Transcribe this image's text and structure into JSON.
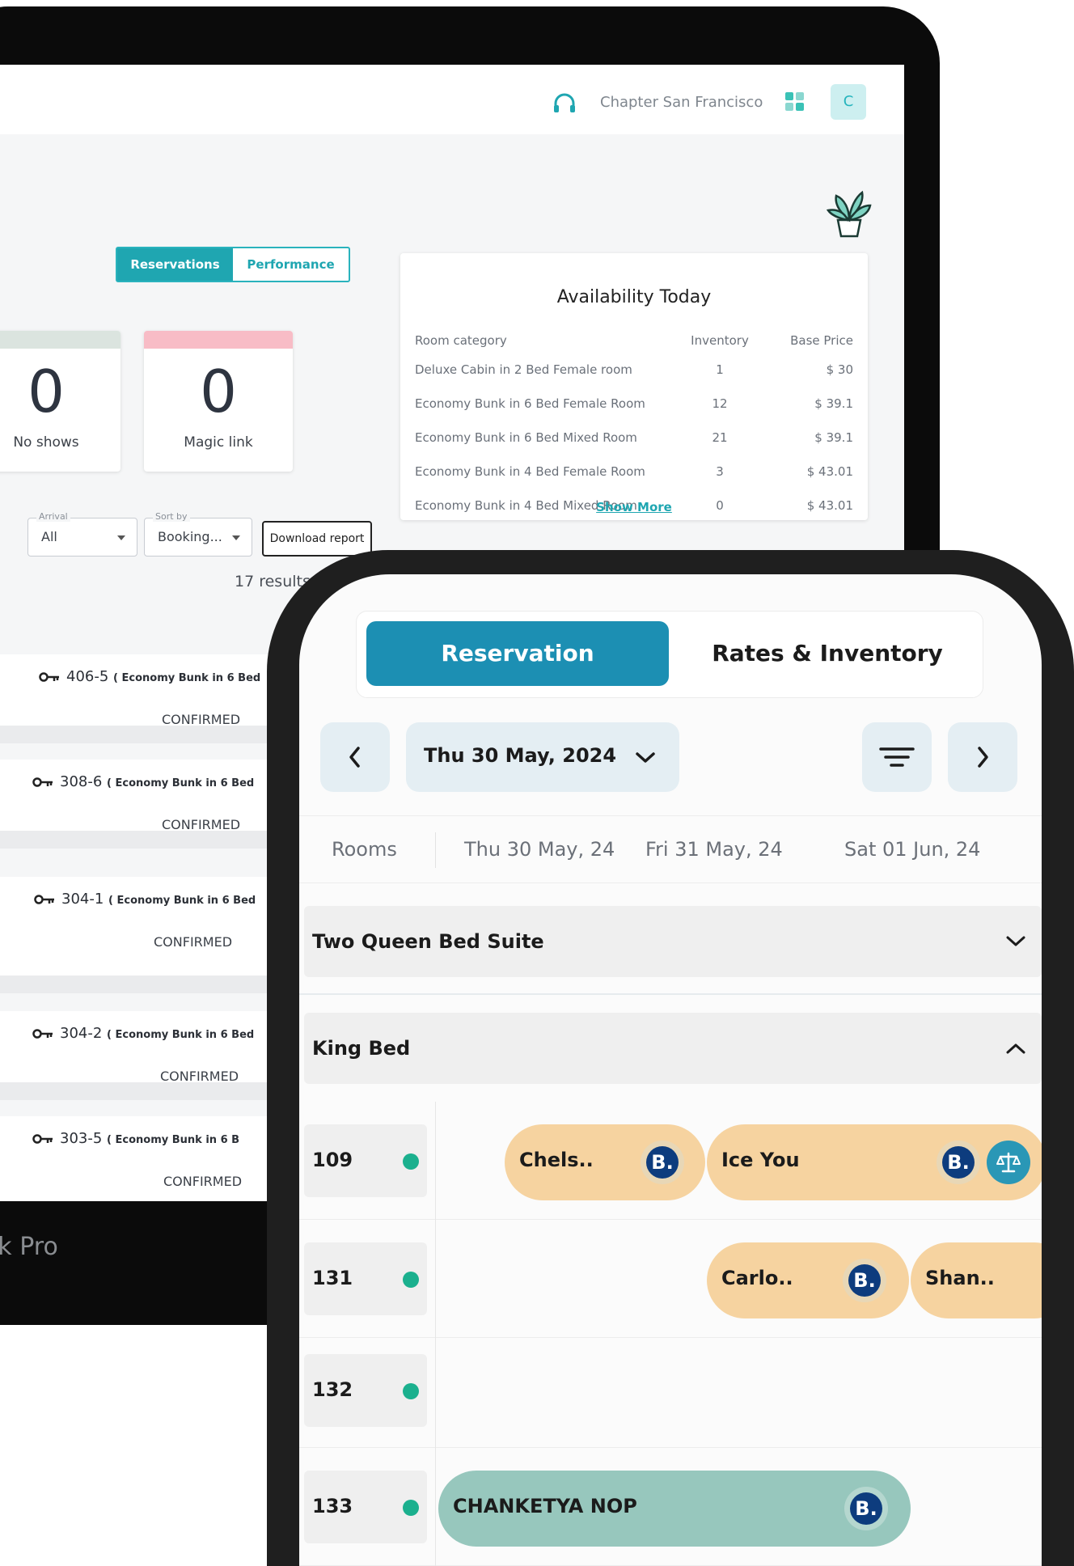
{
  "laptop": {
    "property_name": "Chapter San Francisco",
    "avatar_initial": "C",
    "tabs": [
      "Reservations",
      "Performance"
    ],
    "stats": [
      {
        "value": "0",
        "label": "No shows",
        "color": "#dbe4df"
      },
      {
        "value": "0",
        "label": "Magic link",
        "color": "#f8bcc6"
      }
    ],
    "filters": {
      "arrival": {
        "caption": "Arrival",
        "value": "All"
      },
      "sort": {
        "caption": "Sort by",
        "value": "Booking..."
      },
      "download_label": "Download report"
    },
    "results_count": "17 results",
    "availability": {
      "title": "Availability Today",
      "columns": [
        "Room category",
        "Inventory",
        "Base Price"
      ],
      "rows": [
        [
          "Deluxe Cabin in 2 Bed Female room",
          "1",
          "$ 30"
        ],
        [
          "Economy Bunk in 6 Bed Female Room",
          "12",
          "$ 39.1"
        ],
        [
          "Economy Bunk in 6 Bed Mixed Room",
          "21",
          "$ 39.1"
        ],
        [
          "Economy Bunk in 4 Bed Female Room",
          "3",
          "$ 43.01"
        ],
        [
          "Economy Bunk in 4 Bed Mixed Room",
          "0",
          "$ 43.01"
        ]
      ],
      "show_more": "Show More"
    },
    "reservations": [
      {
        "room": "406-5",
        "category": "( Economy Bunk in 6 Bed",
        "status": "CONFIRMED"
      },
      {
        "room": "308-6",
        "category": "( Economy Bunk in 6 Bed",
        "status": "CONFIRMED"
      },
      {
        "room": "304-1",
        "category": "( Economy Bunk in 6 Bed",
        "status": "CONFIRMED"
      },
      {
        "room": "304-2",
        "category": "( Economy Bunk in 6 Bed",
        "status": "CONFIRMED"
      },
      {
        "room": "303-5",
        "category": "( Economy Bunk in 6 B",
        "status": "CONFIRMED"
      }
    ],
    "brand": "Book Pro"
  },
  "phone": {
    "tabs": {
      "reservation": "Reservation",
      "rates": "Rates & Inventory"
    },
    "selected_date": "Thu 30 May, 2024",
    "columns": [
      "Rooms",
      "Thu 30 May, 24",
      "Fri 31 May, 24",
      "Sat 01 Jun, 24"
    ],
    "categories": [
      {
        "name": "Two Queen Bed Suite",
        "expanded": false
      },
      {
        "name": "King Bed",
        "expanded": true
      }
    ],
    "rooms": [
      {
        "number": "109",
        "bookings": [
          "Chels..",
          "Ice You"
        ]
      },
      {
        "number": "131",
        "bookings": [
          "Carlo..",
          "Shan.."
        ]
      },
      {
        "number": "132",
        "bookings": []
      },
      {
        "number": "133",
        "bookings": [
          "CHANKETYA NOP"
        ]
      }
    ],
    "badge_letter": "B.",
    "colors": {
      "accent": "#1c8fb3",
      "booking": "#f6d3a0",
      "checked_in": "#97c7bd",
      "available": "#1bb08e"
    }
  }
}
